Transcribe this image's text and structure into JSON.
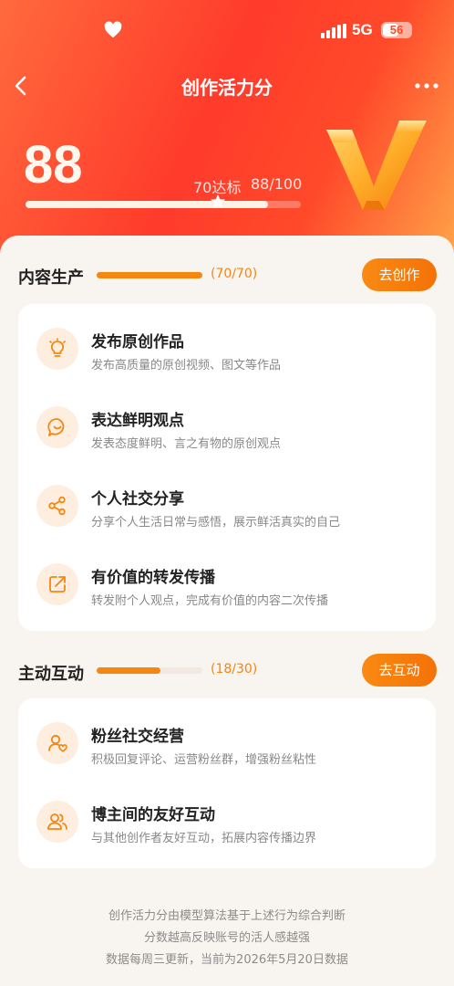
{
  "status_bar": {
    "network": "5G",
    "battery": "56",
    "battery_level": 0.56
  },
  "header": {
    "title": "创作活力分"
  },
  "score": {
    "value": "88",
    "target_label": "70达标",
    "fraction_text": "88/100",
    "progress": 0.88,
    "target_marker": 0.7
  },
  "sections": {
    "content": {
      "title": "内容生产",
      "count": "(70/70)",
      "progress": 1.0,
      "button": "去创作",
      "items": [
        {
          "icon": "lightbulb-icon",
          "title": "发布原创作品",
          "desc": "发布高质量的原创视频、图文等作品"
        },
        {
          "icon": "chat-bubble-icon",
          "title": "表达鲜明观点",
          "desc": "发表态度鲜明、言之有物的原创观点"
        },
        {
          "icon": "share-icon",
          "title": "个人社交分享",
          "desc": "分享个人生活日常与感悟，展示鲜活真实的自己"
        },
        {
          "icon": "forward-icon",
          "title": "有价值的转发传播",
          "desc": "转发附个人观点，完成有价值的内容二次传播"
        }
      ]
    },
    "interaction": {
      "title": "主动互动",
      "count": "(18/30)",
      "progress": 0.6,
      "button": "去互动",
      "items": [
        {
          "icon": "user-heart-icon",
          "title": "粉丝社交经营",
          "desc": "积极回复评论、运营粉丝群，增强粉丝粘性"
        },
        {
          "icon": "users-icon",
          "title": "博主间的友好互动",
          "desc": "与其他创作者友好互动，拓展内容传播边界"
        }
      ]
    }
  },
  "footer": {
    "line1": "创作活力分由模型算法基于上述行为综合判断",
    "line2": "分数越高反映账号的活人感越强",
    "line3": "数据每周三更新，当前为2026年5月20日数据"
  },
  "colors": {
    "accent": "#f5860f",
    "hero_red": "#ff3b2b",
    "background": "#f8f4ef"
  }
}
